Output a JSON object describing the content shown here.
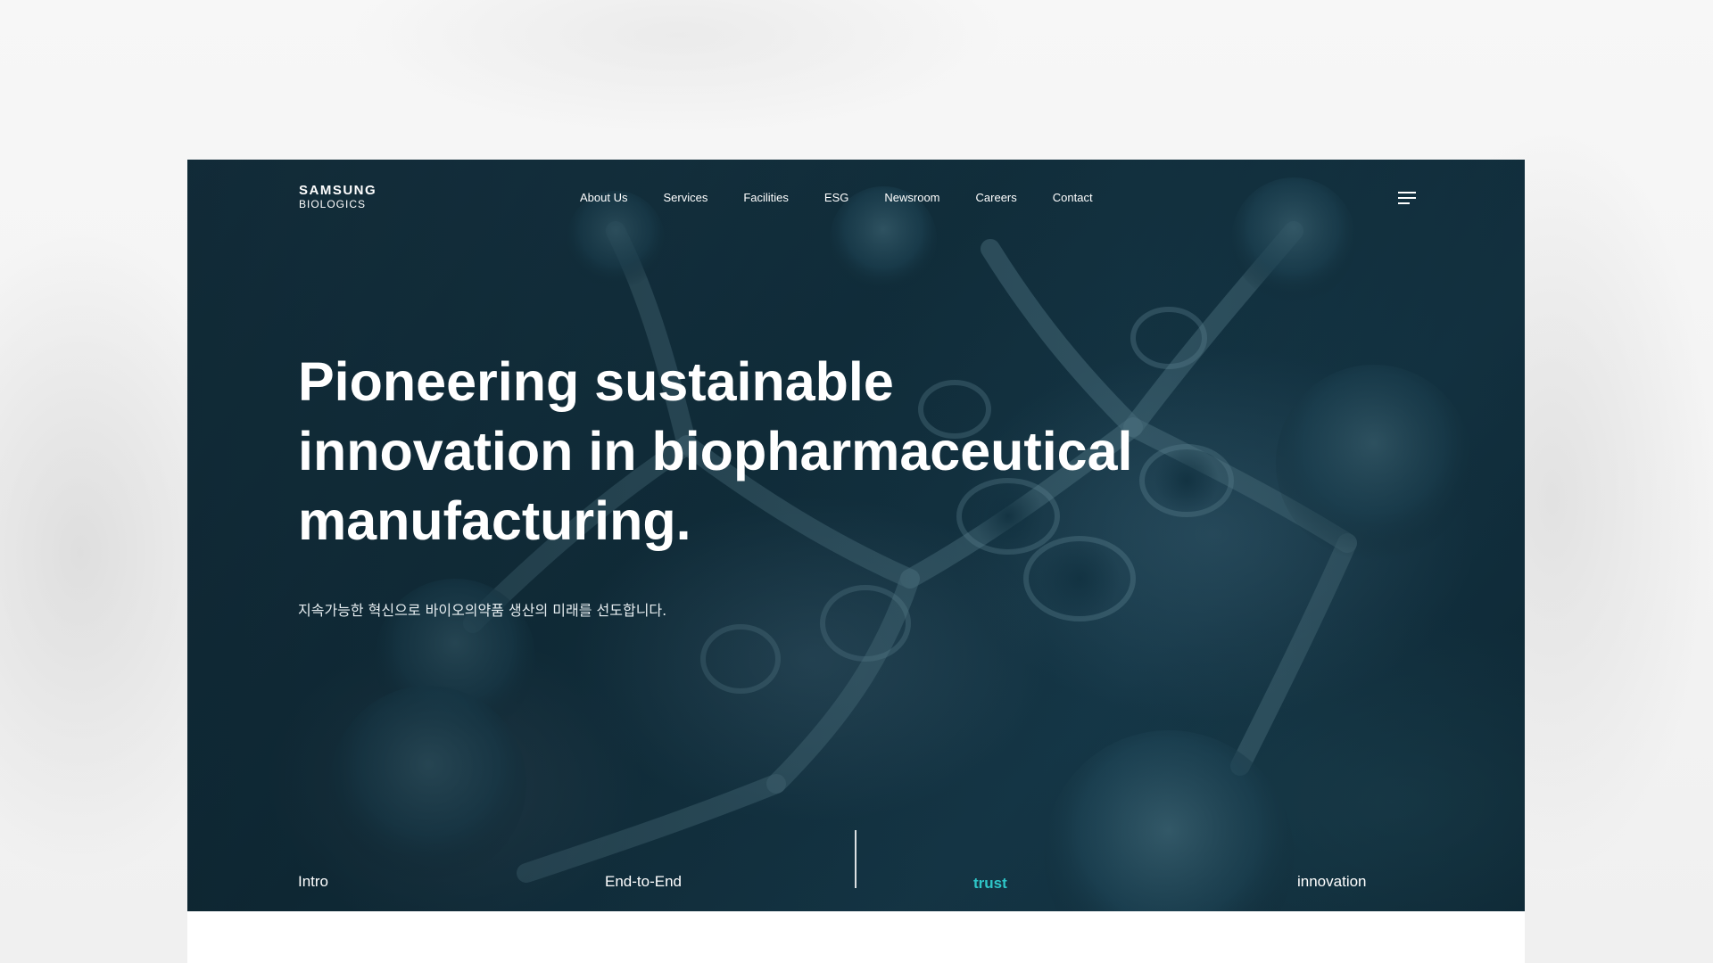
{
  "brand": {
    "line1": "SAMSUNG",
    "line2": "BIOLOGICS"
  },
  "nav": {
    "items": [
      "About Us",
      "Services",
      "Facilities",
      "ESG",
      "Newsroom",
      "Careers",
      "Contact"
    ]
  },
  "menu": {
    "icon": "hamburger-menu-icon"
  },
  "hero": {
    "headline_lines": [
      "Pioneering sustainable",
      "innovation in biopharmaceutical",
      "manufacturing."
    ],
    "subtext": "지속가능한 혁신으로 바이오의약품 생산의 미래를 선도합니다."
  },
  "tabs": {
    "items": [
      "Intro",
      "End-to-End",
      "trust",
      "innovation"
    ],
    "active": "trust"
  },
  "colors": {
    "accent": "#2ec6c8",
    "hero_dark": "#13303d",
    "text": "#ffffff"
  }
}
